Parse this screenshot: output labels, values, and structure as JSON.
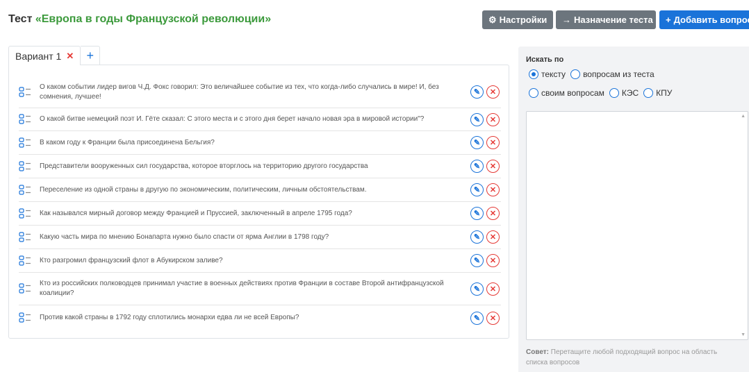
{
  "header": {
    "title_prefix": "Тест ",
    "title_name": "«Европа в годы Французской революции»"
  },
  "toolbar": {
    "settings_label": "Настройки",
    "assign_label": "Назначение теста",
    "add_label": "Добавить вопрос"
  },
  "tabs": {
    "variant_label": "Вариант 1",
    "close_glyph": "✕",
    "add_glyph": "+"
  },
  "questions": [
    {
      "text": "О каком событии лидер вигов Ч.Д. Фокс говорил: Это величайшее событие из тех, что когда-либо случались в мире! И, без сомнения, лучшее!"
    },
    {
      "text": "О какой битве немецкий поэт И. Гёте сказал: С этого места и с этого дня берет начало новая эра в мировой истории\"?"
    },
    {
      "text": "В каком году к Франции была присоединена Бельгия?"
    },
    {
      "text": "Представители вооруженных сил государства, которое вторглось на территорию другого государства"
    },
    {
      "text": "Переселение из одной страны в другую по экономическим, политическим, личным обстоятельствам."
    },
    {
      "text": "Как назывался мирный договор между Францией и Пруссией, заключенный в апреле 1795 года?"
    },
    {
      "text": "Какую часть мира по мнению Бонапарта нужно было спасти от ярма Англии в 1798 году?"
    },
    {
      "text": "Кто разгромил французский флот в Абукирском заливе?"
    },
    {
      "text": "Кто из российских полководцев принимал участие в военных действиях против Франции в составе Второй антифранцузской коалиции?"
    },
    {
      "text": "Против какой страны в 1792 году сплотились монархи едва ли не всей Европы?"
    }
  ],
  "search": {
    "title": "Искать по",
    "options": [
      {
        "label": "тексту",
        "checked": true
      },
      {
        "label": "вопросам из теста",
        "checked": false
      },
      {
        "label": "своим вопросам",
        "checked": false
      },
      {
        "label": "КЭС",
        "checked": false
      },
      {
        "label": "КПУ",
        "checked": false
      }
    ],
    "tip_bold": "Совет:",
    "tip_text": " Перетащите любой подходящий вопрос на область списка вопросов"
  },
  "colors": {
    "accent_blue": "#1a73d9",
    "danger_red": "#e53935",
    "title_green": "#3c9a3c",
    "secondary_gray": "#6c757d"
  }
}
